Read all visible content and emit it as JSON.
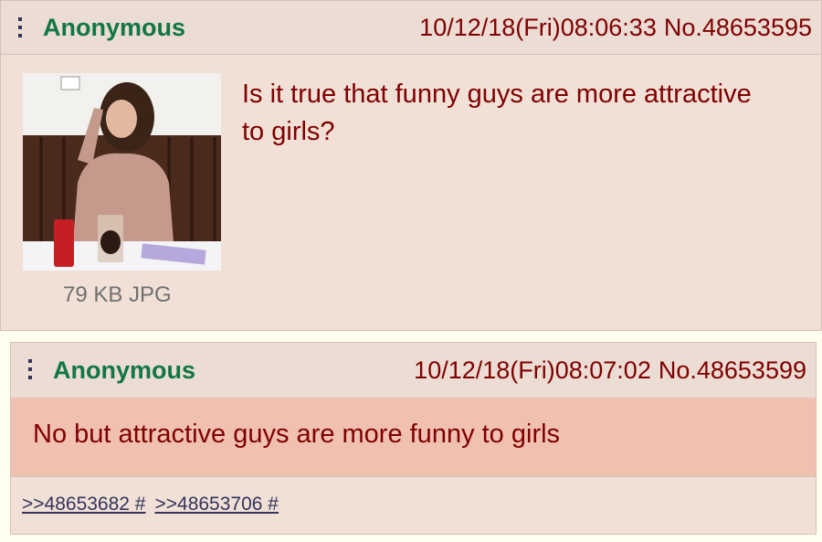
{
  "op": {
    "name": "Anonymous",
    "datetime": "10/12/18(Fri)08:06:33",
    "post_no": "No.48653595",
    "file_info": "79 KB JPG",
    "comment": "Is it true that funny guys are more attractive to girls?",
    "menu_icon": "vertical-ellipsis-icon"
  },
  "reply": {
    "name": "Anonymous",
    "datetime": "10/12/18(Fri)08:07:02",
    "post_no": "No.48653599",
    "comment": "No but attractive guys are more funny to girls",
    "backlinks": [
      ">>48653682 #",
      ">>48653706 #"
    ],
    "menu_icon": "vertical-ellipsis-icon"
  },
  "colors": {
    "name": "#117743",
    "text": "#800000",
    "link": "#34345c",
    "post_bg": "#f0e0d6",
    "highlight_bg": "#f0c0b0"
  }
}
